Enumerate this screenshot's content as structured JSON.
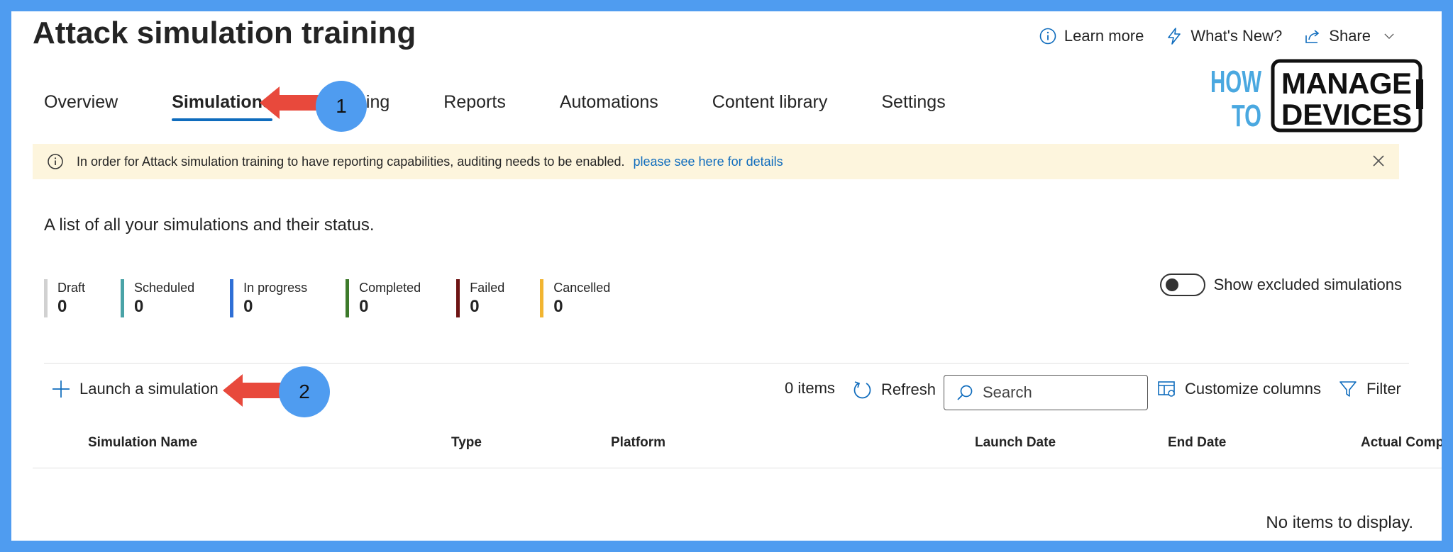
{
  "page_title": "Attack simulation training",
  "header_actions": {
    "learn_more": "Learn more",
    "whats_new": "What's New?",
    "share": "Share"
  },
  "tabs": [
    {
      "label": "Overview"
    },
    {
      "label": "Simulations"
    },
    {
      "label": "Training"
    },
    {
      "label": "Reports"
    },
    {
      "label": "Automations"
    },
    {
      "label": "Content library"
    },
    {
      "label": "Settings"
    }
  ],
  "annotations": {
    "callout_1": "1",
    "callout_2": "2"
  },
  "logo": {
    "how": "HOW",
    "to": "TO",
    "manage": "MANAGE",
    "devices": "DEVICES"
  },
  "banner": {
    "message": "In order for Attack simulation training to have reporting capabilities, auditing needs to be enabled.",
    "link": "please see here for details"
  },
  "subtitle": "A list of all your simulations and their status.",
  "status_counts": [
    {
      "label": "Draft",
      "value": "0",
      "color": "#d1d1d1"
    },
    {
      "label": "Scheduled",
      "value": "0",
      "color": "#4aa3a7"
    },
    {
      "label": "In progress",
      "value": "0",
      "color": "#2f6fd6"
    },
    {
      "label": "Completed",
      "value": "0",
      "color": "#3d7a2b"
    },
    {
      "label": "Failed",
      "value": "0",
      "color": "#6e1414"
    },
    {
      "label": "Cancelled",
      "value": "0",
      "color": "#f2b531"
    }
  ],
  "toggle": {
    "label": "Show excluded simulations",
    "on": false
  },
  "toolbar": {
    "launch": "Launch a simulation",
    "items_count": "0 items",
    "refresh": "Refresh",
    "search_placeholder": "Search",
    "customize": "Customize columns",
    "filter": "Filter"
  },
  "table": {
    "columns": [
      "Simulation Name",
      "Type",
      "Platform",
      "Launch Date",
      "End Date",
      "Actual Compr"
    ],
    "empty_text": "No items to display."
  },
  "colors": {
    "frame": "#4f9cf0",
    "accent": "#0f6cbd",
    "banner_bg": "#fdf5dd",
    "arrow": "#e8493c",
    "logo_blue": "#4aa8e0"
  }
}
